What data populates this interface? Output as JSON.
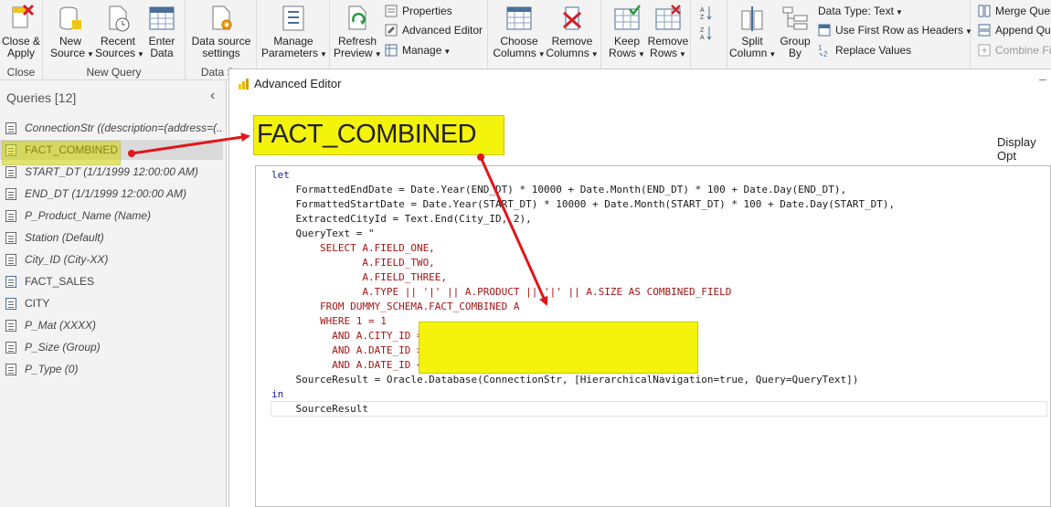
{
  "ribbon": {
    "close": {
      "btn1": "Close &",
      "btn2": "Apply",
      "group": "Close"
    },
    "new_query": {
      "new1": "New",
      "new2": "Source",
      "recent1": "Recent",
      "recent2": "Sources",
      "enter1": "Enter",
      "enter2": "Data",
      "group": "New Query"
    },
    "data_sources": {
      "btn1": "Data source",
      "btn2": "settings",
      "group": "Data So"
    },
    "params": {
      "btn1": "Manage",
      "btn2": "Parameters"
    },
    "query": {
      "refresh1": "Refresh",
      "refresh2": "Preview",
      "properties": "Properties",
      "advanced_editor": "Advanced Editor",
      "manage": "Manage"
    },
    "columns": {
      "choose1": "Choose",
      "choose2": "Columns",
      "remove1": "Remove",
      "remove2": "Columns"
    },
    "rows": {
      "keep1": "Keep",
      "keep2": "Rows",
      "remove1": "Remove",
      "remove2": "Rows"
    },
    "transform": {
      "split1": "Split",
      "split2": "Column",
      "group1": "Group",
      "group2": "By",
      "data_type": "Data Type: Text",
      "first_row": "Use First Row as Headers",
      "replace": "Replace Values"
    },
    "combine": {
      "merge": "Merge Quer",
      "append": "Append Qu",
      "combine_files": "Combine Fil"
    }
  },
  "queries_pane": {
    "title": "Queries [12]",
    "items": [
      {
        "label": "ConnectionStr ((description=(address=(...",
        "param": true
      },
      {
        "label": "FACT_COMBINED",
        "param": false
      },
      {
        "label": "START_DT (1/1/1999 12:00:00 AM)",
        "param": true
      },
      {
        "label": "END_DT (1/1/1999 12:00:00 AM)",
        "param": true
      },
      {
        "label": "P_Product_Name (Name)",
        "param": true
      },
      {
        "label": "Station (Default)",
        "param": true
      },
      {
        "label": "City_ID (City-XX)",
        "param": true
      },
      {
        "label": "FACT_SALES",
        "param": false
      },
      {
        "label": "CITY",
        "param": false
      },
      {
        "label": "P_Mat (XXXX)",
        "param": true
      },
      {
        "label": "P_Size (Group)",
        "param": true
      },
      {
        "label": "P_Type (0)",
        "param": true
      }
    ]
  },
  "advanced_editor": {
    "title": "Advanced Editor",
    "display_options": "Display Opt",
    "code_lines": [
      "let",
      "    FormattedEndDate = Date.Year(END_DT) * 10000 + Date.Month(END_DT) * 100 + Date.Day(END_DT),",
      "    FormattedStartDate = Date.Year(START_DT) * 10000 + Date.Month(START_DT) * 100 + Date.Day(START_DT),",
      "    ExtractedCityId = Text.End(City_ID, 2),",
      "    QueryText = \"",
      "        SELECT A.FIELD_ONE,",
      "               A.FIELD_TWO,",
      "               A.FIELD_THREE,",
      "               A.TYPE || '|' || A.PRODUCT || '|' || A.SIZE AS COMBINED_FIELD",
      "        FROM DUMMY_SCHEMA.FACT_COMBINED A",
      "        WHERE 1 = 1",
      "          AND A.CITY_ID = '\" & ExtractedCityId & \"'",
      "          AND A.DATE_ID >= \" & Number.ToText(FormattedStartDate) & \"",
      "          AND A.DATE_ID <= \" & Number.ToText(FormattedEndDate),",
      "    SourceResult = Oracle.Database(ConnectionStr, [HierarchicalNavigation=true, Query=QueryText])",
      "in",
      "    SourceResult"
    ]
  },
  "callouts": {
    "main": "FACT_COMBINED"
  },
  "colors": {
    "highlight_yellow": "#f4f30b",
    "arrow_red": "#e0161b",
    "pane_bg": "#f3f3f3"
  }
}
